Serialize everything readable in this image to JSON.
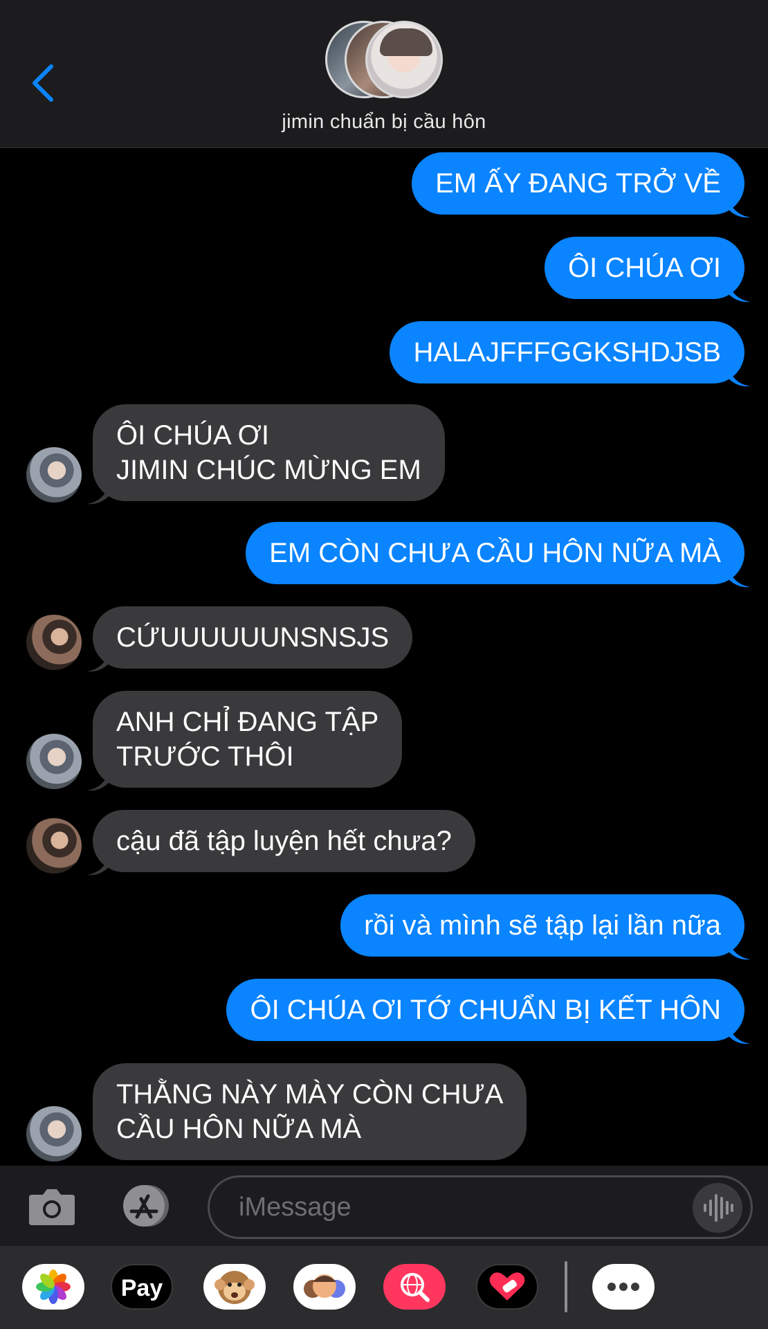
{
  "header": {
    "contact_name": "jimin chuẩn bị cầu hôn"
  },
  "messages": [
    {
      "side": "out",
      "text": "EM ẤY ĐANG TRỞ VỀ"
    },
    {
      "side": "out",
      "text": "ÔI CHÚA ƠI"
    },
    {
      "side": "out",
      "text": "HALAJFFFGGKSHDJSB"
    },
    {
      "side": "in",
      "sender_icon": "jin-avatar",
      "lines": [
        "ÔI CHÚA ƠI",
        "JIMIN CHÚC MỪNG EM"
      ]
    },
    {
      "side": "out",
      "text": "EM CÒN CHƯA CẦU HÔN NỮA MÀ"
    },
    {
      "side": "in",
      "sender_icon": "tae-avatar",
      "text": "CỨUUUUUUNSNSJS"
    },
    {
      "side": "in",
      "sender_icon": "jin-avatar",
      "lines": [
        "ANH CHỈ ĐANG TẬP",
        "TRƯỚC THÔI"
      ]
    },
    {
      "side": "in",
      "sender_icon": "tae-avatar",
      "text": "cậu đã tập luyện hết chưa?"
    },
    {
      "side": "out",
      "text": "rồi và mình sẽ tập lại lần nữa"
    },
    {
      "side": "out",
      "text": "ÔI CHÚA ƠI TỚ CHUẨN BỊ KẾT HÔN"
    },
    {
      "side": "in",
      "sender_icon": "jin-avatar",
      "lines": [
        "THẰNG NÀY MÀY CÒN CHƯA",
        "CẦU HÔN NỮA MÀ"
      ]
    }
  ],
  "input": {
    "placeholder": "iMessage"
  },
  "app_drawer": {
    "apps": [
      "photos-app-icon",
      "apple-pay-icon",
      "animoji-icon",
      "memoji-icon",
      "web-images-icon",
      "digital-touch-icon",
      "more-icon"
    ],
    "apple_pay_label": "Pay"
  },
  "colors": {
    "outgoing_bubble": "#0a84ff",
    "incoming_bubble": "#3a3a3c",
    "background": "#000000",
    "bar_background": "#1c1c1e"
  }
}
